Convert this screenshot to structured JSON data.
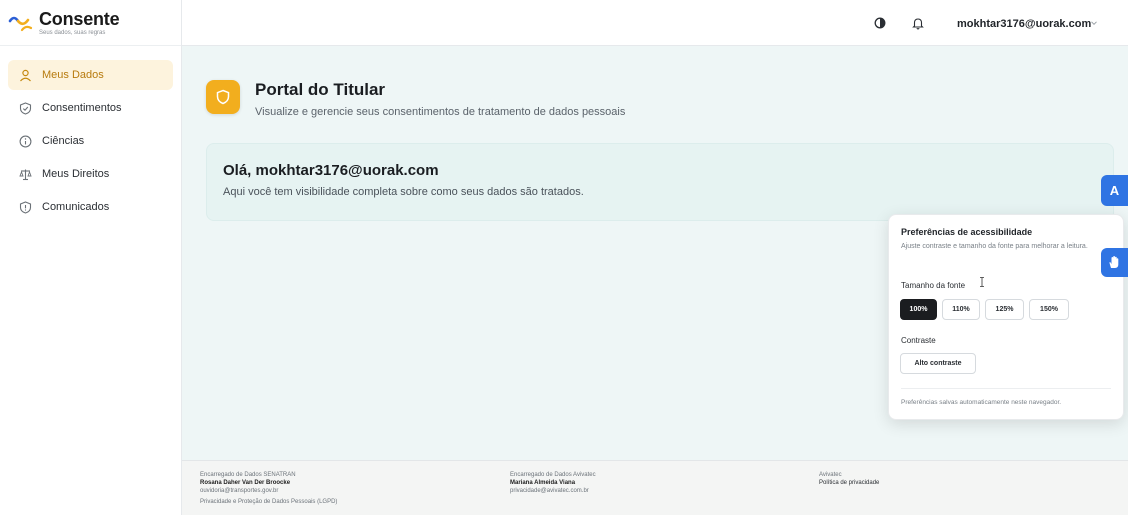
{
  "brand": {
    "name": "Consente",
    "tagline": "Seus dados, suas regras"
  },
  "sidebar": {
    "items": [
      {
        "label": "Meus Dados",
        "icon": "user-icon",
        "active": true
      },
      {
        "label": "Consentimentos",
        "icon": "shield-check-icon"
      },
      {
        "label": "Ciências",
        "icon": "info-icon"
      },
      {
        "label": "Meus Direitos",
        "icon": "scale-icon"
      },
      {
        "label": "Comunicados",
        "icon": "alert-shield-icon"
      }
    ]
  },
  "header": {
    "user_email": "mokhtar3176@uorak.com",
    "icons": [
      "contrast-icon",
      "bell-icon",
      "chevron-down-icon"
    ]
  },
  "main": {
    "title": "Portal do Titular",
    "subtitle": "Visualize e gerencie seus consentimentos de tratamento de dados pessoais",
    "welcome": {
      "title": "Olá, mokhtar3176@uorak.com",
      "text": "Aqui você tem visibilidade completa sobre como seus dados são tratados."
    }
  },
  "accessibility": {
    "toggle_label": "A",
    "panel": {
      "title": "Preferências de acessibilidade",
      "description": "Ajuste contraste e tamanho da fonte para melhorar a leitura.",
      "font_size_label": "Tamanho da fonte",
      "font_sizes": [
        "100%",
        "110%",
        "125%",
        "150%"
      ],
      "selected_font_size": "100%",
      "contrast_label": "Contraste",
      "contrast_button": "Alto contraste",
      "note": "Preferências salvas automaticamente neste navegador."
    }
  },
  "footer": {
    "col1": {
      "heading": "Encarregado de Dados SENATRAN",
      "name": "Rosana Daher Van Der Broocke",
      "email": "ouvidoria@transportes.gov.br",
      "extra": "Privacidade e Proteção de Dados Pessoais (LGPD)"
    },
    "col2": {
      "heading": "Encarregado de Dados Avivatec",
      "name": "Mariana Almeida Viana",
      "email": "privacidade@avivatec.com.br"
    },
    "col3": {
      "heading": "Avivatec",
      "link": "Política de privacidade"
    }
  },
  "colors": {
    "accent": "#f2ae1e",
    "primary_blue": "#2f74e3",
    "active_bg": "#fdf3dd"
  }
}
